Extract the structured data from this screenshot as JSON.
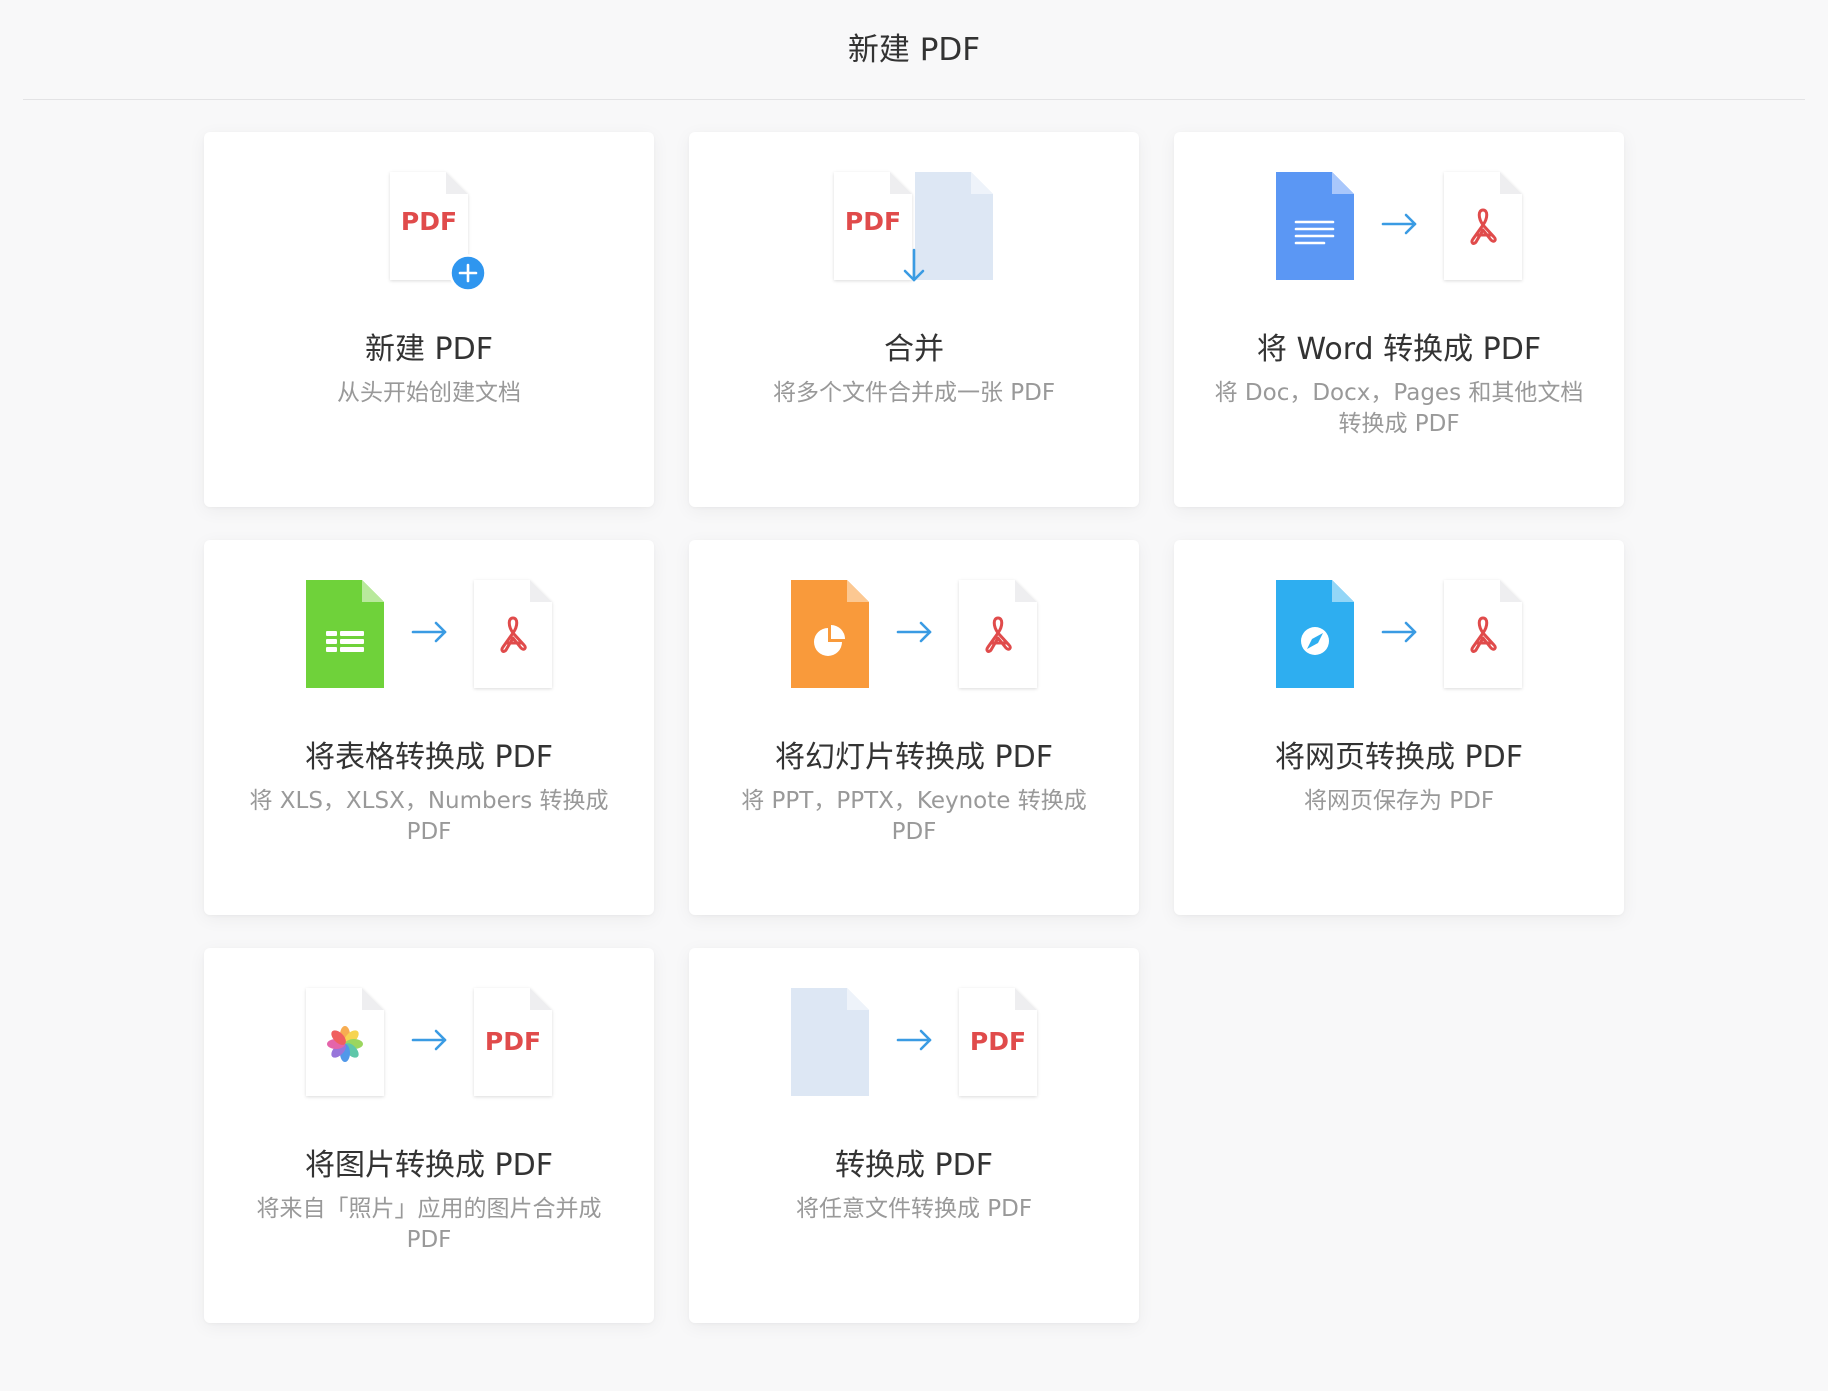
{
  "header": {
    "title": "新建 PDF"
  },
  "colors": {
    "page_bg": "#f8f8f9",
    "title_text": "#333333",
    "subtitle_text": "#999999",
    "divider": "#e3e3e5",
    "pdf_red": "#e04b4b",
    "accent_blue": "#3a9be3",
    "plus_blue": "#2f96ef",
    "word_blue": "#5b97f4",
    "sheet_green": "#6fd23a",
    "slide_orange": "#f99a3b",
    "web_cyan": "#2eaef0",
    "plain_doc": "#dde7f4"
  },
  "cards": [
    {
      "title": "新建 PDF",
      "subtitle": "从头开始创建文档",
      "icon": "new-pdf-document-icon",
      "badge": "PDF"
    },
    {
      "title": "合并",
      "subtitle": "将多个文件合并成一张 PDF",
      "icon": "merge-documents-icon",
      "badge": "PDF"
    },
    {
      "title": "将 Word 转换成 PDF",
      "subtitle": "将 Doc，Docx，Pages 和其他文档转换成 PDF",
      "source_icon": "word-document-icon",
      "target_icon": "acrobat-document-icon"
    },
    {
      "title": "将表格转换成 PDF",
      "subtitle": "将 XLS，XLSX，Numbers 转换成 PDF",
      "source_icon": "spreadsheet-document-icon",
      "target_icon": "acrobat-document-icon"
    },
    {
      "title": "将幻灯片转换成 PDF",
      "subtitle": "将 PPT，PPTX，Keynote 转换成 PDF",
      "source_icon": "slides-document-icon",
      "target_icon": "acrobat-document-icon"
    },
    {
      "title": "将网页转换成 PDF",
      "subtitle": "将网页保存为 PDF",
      "source_icon": "web-page-document-icon",
      "target_icon": "acrobat-document-icon"
    },
    {
      "title": "将图片转换成 PDF",
      "subtitle": "将来自「照片」应用的图片合并成 PDF",
      "source_icon": "photos-icon",
      "target_icon": "pdf-document-icon",
      "badge": "PDF"
    },
    {
      "title": "转换成 PDF",
      "subtitle": "将任意文件转换成 PDF",
      "source_icon": "generic-document-icon",
      "target_icon": "pdf-document-icon",
      "badge": "PDF"
    }
  ]
}
